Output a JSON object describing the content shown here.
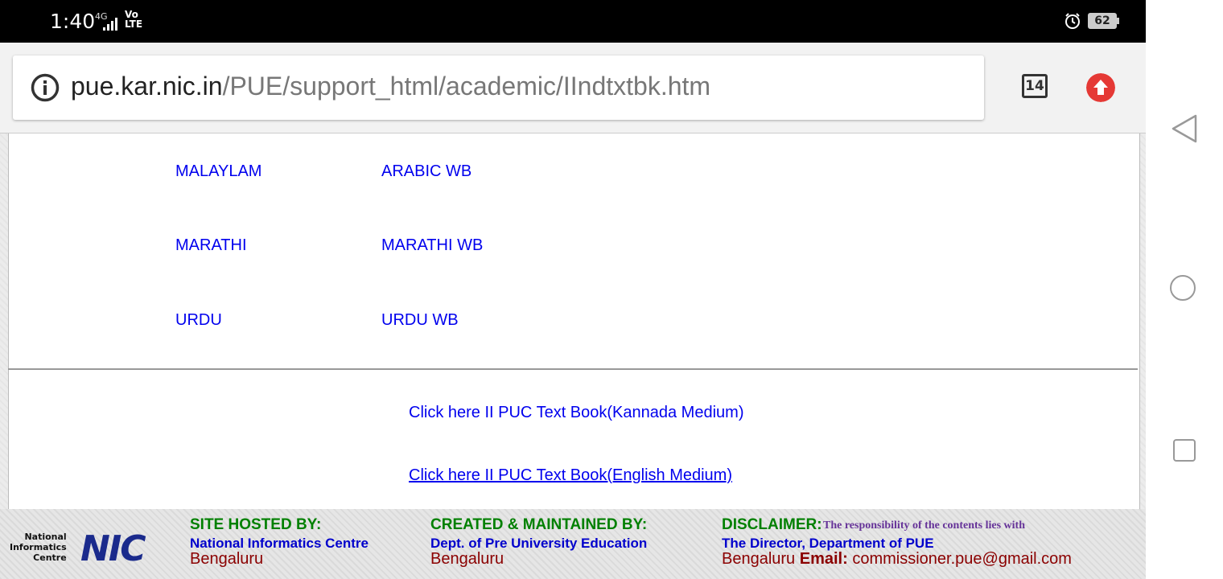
{
  "status": {
    "time": "1:40",
    "network": "4G",
    "volte": "Vo LTE",
    "battery": "62"
  },
  "browser": {
    "url_domain": "pue.kar.nic.in",
    "url_path": "/PUE/support_html/academic/IIndtxtbk.htm",
    "tab_count": "14"
  },
  "subjects": [
    {
      "left": "MALAYLAM",
      "right": "ARABIC WB"
    },
    {
      "left": "MARATHI",
      "right": "MARATHI WB"
    },
    {
      "left": "URDU",
      "right": "URDU WB"
    }
  ],
  "book_links": {
    "kannada": "Click here II PUC Text Book(Kannada Medium)",
    "english": "Click here II PUC Text Book(English Medium)"
  },
  "footer": {
    "nic_small": [
      "National",
      "Informatics",
      "Centre"
    ],
    "nic_logo": "NIC",
    "hosted_head": "SITE HOSTED BY:",
    "hosted_name": "National Informatics Centre",
    "hosted_city": "Bengaluru",
    "created_head": "CREATED & MAINTAINED BY:",
    "created_name": "Dept. of Pre University Education",
    "created_city": "Bengaluru",
    "disclaimer_head": "DISCLAIMER:",
    "disclaimer_text": "The responsibility of the contents lies with",
    "disclaimer_name": "The Director, Department of PUE",
    "disclaimer_city": "Bengaluru",
    "email_label": "Email:",
    "email": "commissioner.pue@gmail.com"
  }
}
